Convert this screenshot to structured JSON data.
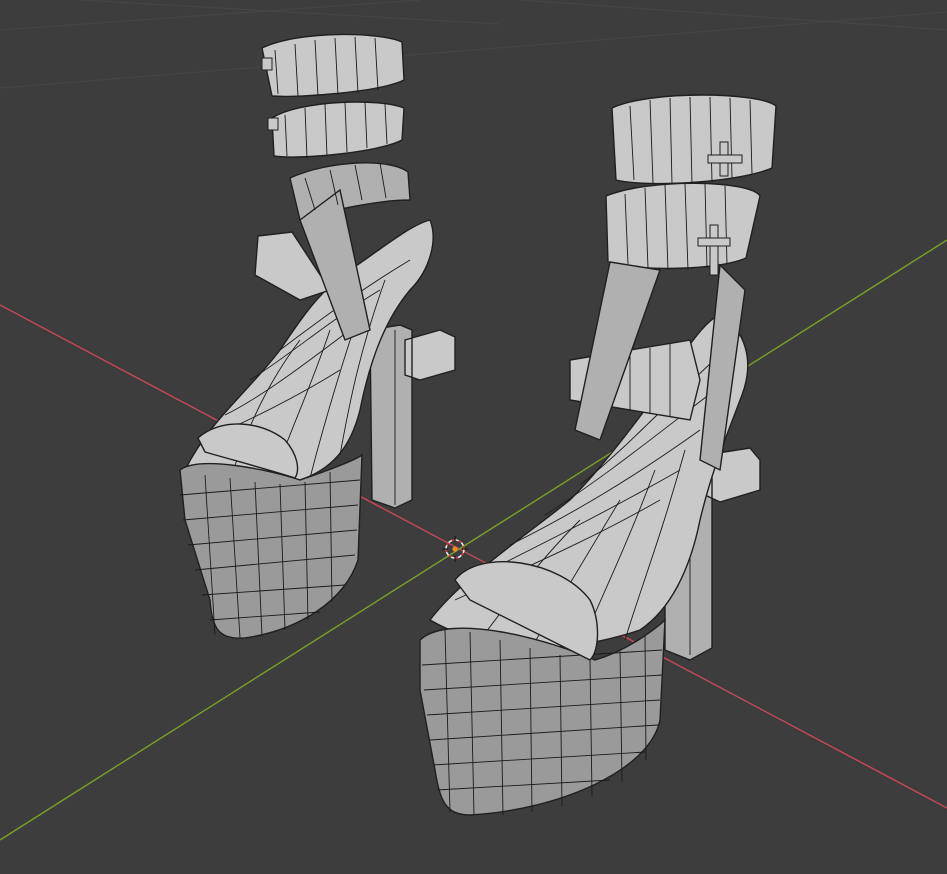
{
  "viewport": {
    "background": "#3d3d3d",
    "grid_color": "#474747",
    "x_axis_color": "#c44a5a",
    "y_axis_color": "#7aa02a",
    "mesh_color": "#b8b8b8",
    "wire_color": "#1b1b1b"
  },
  "scene": {
    "objects": [
      "left-platform-sandal",
      "right-platform-sandal"
    ],
    "cursor_icon": "3d-cursor-icon"
  }
}
